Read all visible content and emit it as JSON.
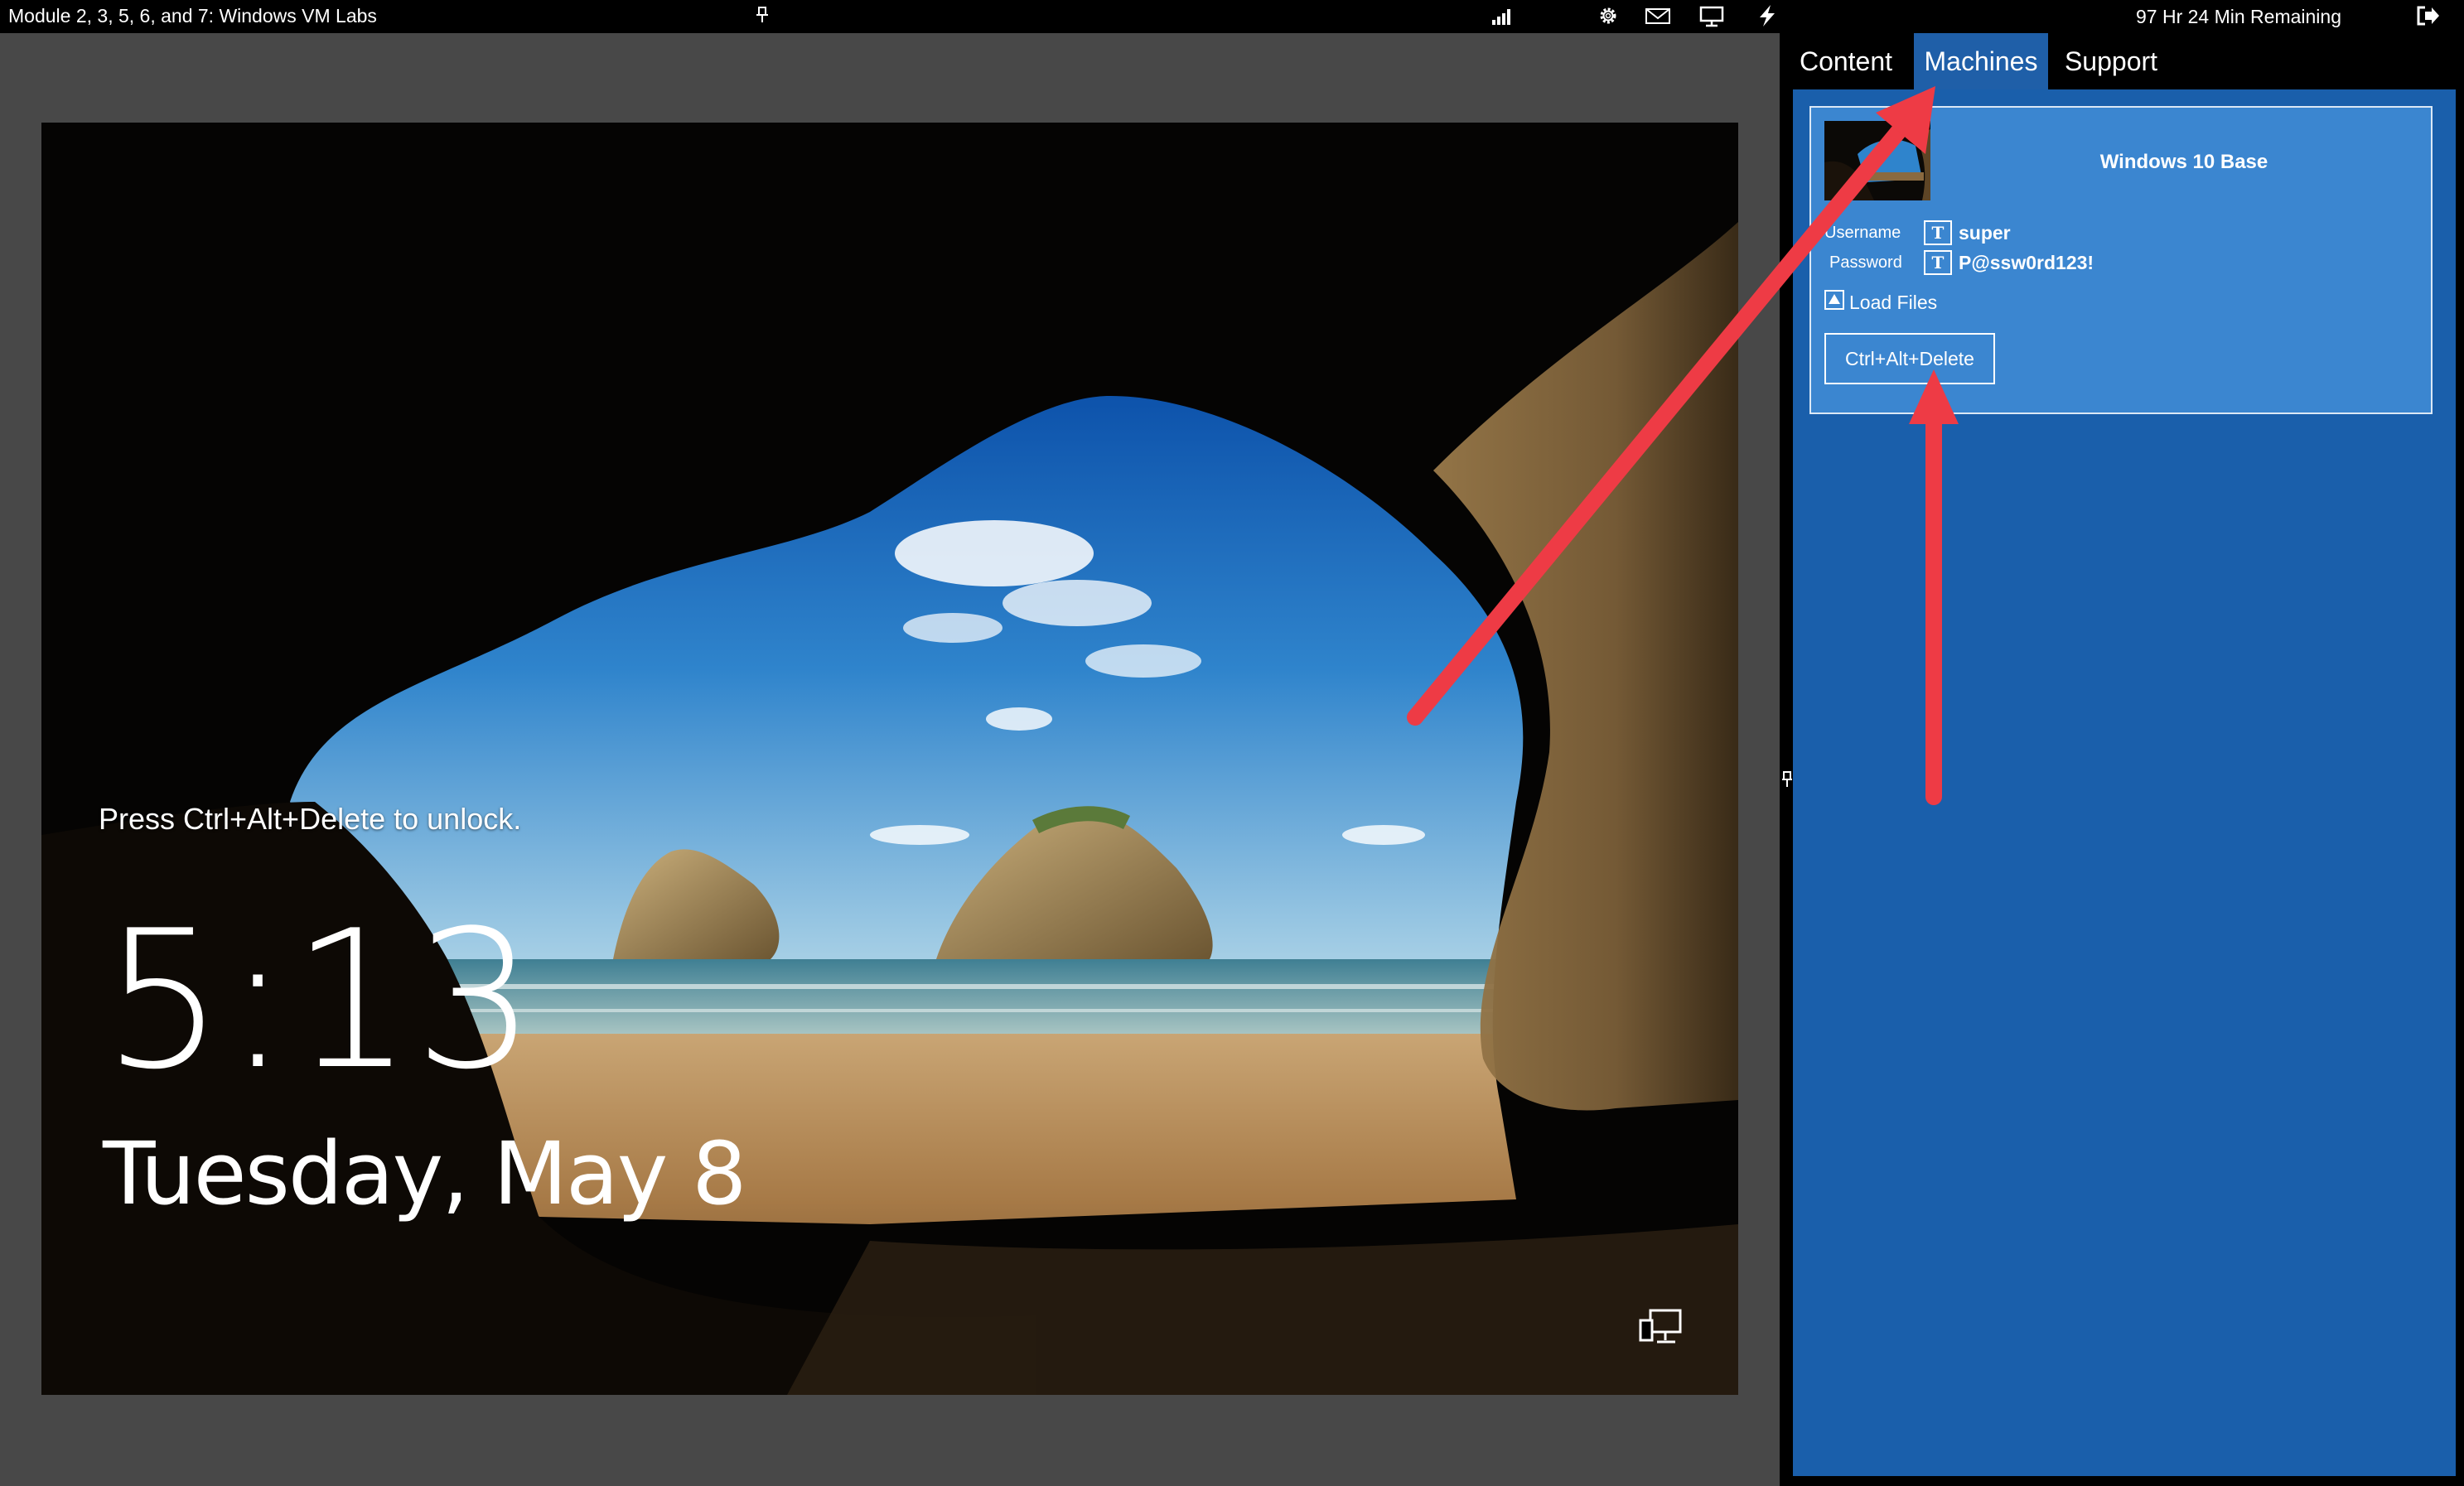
{
  "top_bar": {
    "title": "Module 2, 3, 5, 6, and 7: Windows VM Labs",
    "time_remaining": "97 Hr 24 Min Remaining",
    "icons": [
      "pin-icon",
      "signal-icon",
      "gear-icon",
      "mail-icon",
      "monitor-icon",
      "power-icon",
      "exit-icon"
    ]
  },
  "vm": {
    "lock_prompt": "Press Ctrl+Alt+Delete to unlock.",
    "time": "5:13",
    "date": "Tuesday, May 8",
    "icons": [
      "network-icon"
    ]
  },
  "side_panel": {
    "tabs": [
      {
        "label": "Content",
        "active": false
      },
      {
        "label": "Machines",
        "active": true
      },
      {
        "label": "Support",
        "active": false
      }
    ],
    "machine": {
      "name": "Windows 10 Base",
      "username_label": "Username",
      "username": "super",
      "password_label": "Password",
      "password": "P@ssw0rd123!",
      "load_files": "Load Files",
      "cad_button": "Ctrl+Alt+Delete"
    }
  },
  "colors": {
    "panel_blue": "#1a5fab",
    "card_blue": "#3b86d0",
    "active_tab": "#1f5fa8",
    "annotation_arrow": "#ee3b45",
    "vm_frame": "#484848"
  }
}
